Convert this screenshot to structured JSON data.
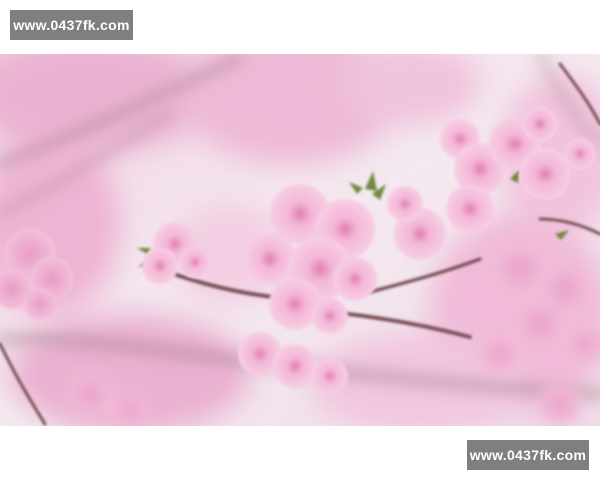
{
  "watermarks": {
    "top": "www.0437fk.com",
    "bottom": "www.0437fk.com"
  },
  "photo": {
    "subject": "cherry-blossom-branch",
    "colors": {
      "background": "#f1e4ec",
      "blossom": "#f0a8cf",
      "blossom_light": "#f7cde4",
      "blossom_dark": "#e58cbc",
      "branch": "#7a5058",
      "leaf": "#6f8a3e"
    }
  }
}
